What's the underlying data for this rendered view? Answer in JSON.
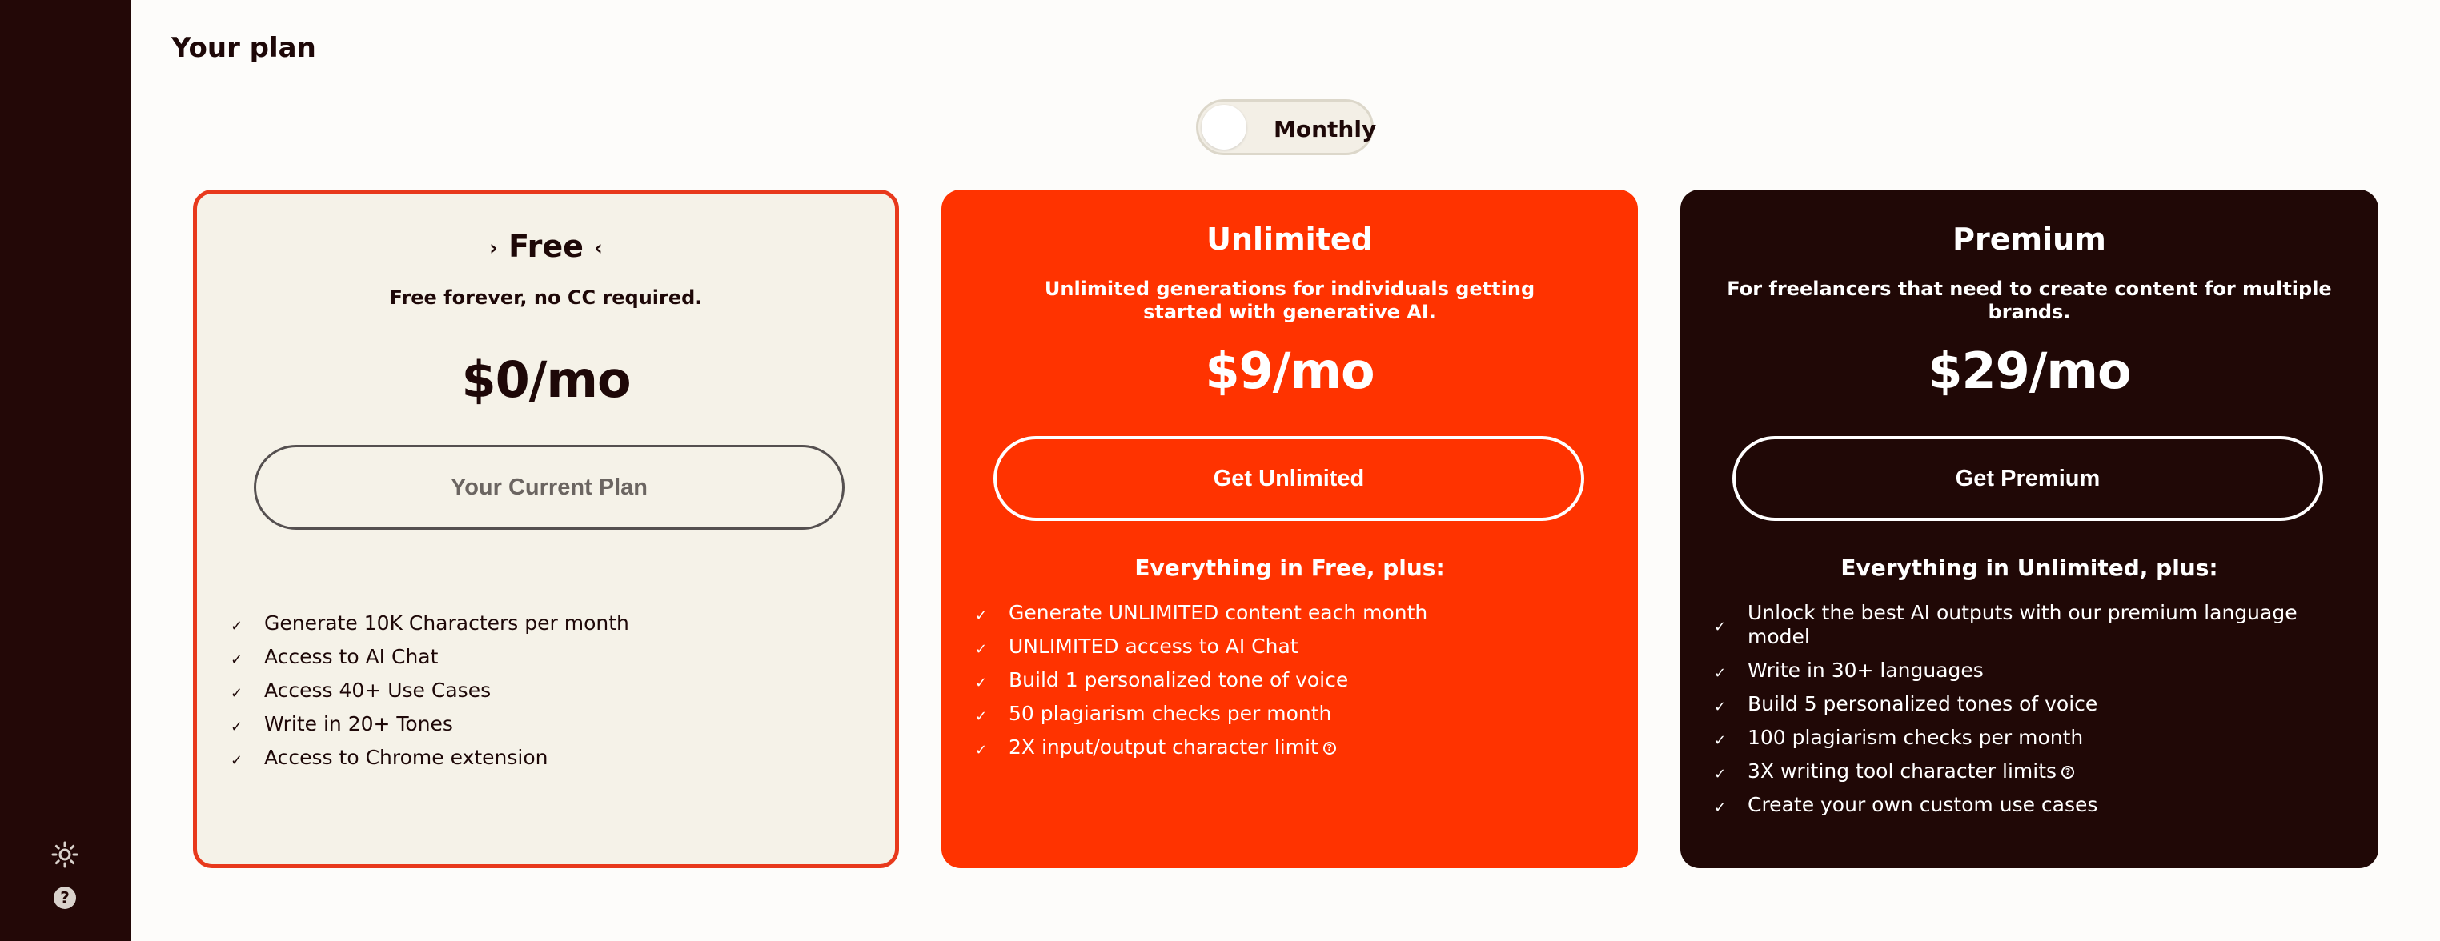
{
  "page": {
    "title": "Your plan"
  },
  "billing_toggle": {
    "label": "Monthly"
  },
  "sidebar": {
    "icons": [
      {
        "name": "theme-sun-icon"
      },
      {
        "name": "help-icon"
      }
    ]
  },
  "plans": {
    "free": {
      "title": "Free",
      "subtitle": "Free forever, no CC required.",
      "price": "$0/mo",
      "button": "Your Current Plan",
      "features": [
        "Generate 10K Characters per month",
        "Access to AI Chat",
        "Access 40+ Use Cases",
        "Write in 20+ Tones",
        "Access to Chrome extension"
      ]
    },
    "unlimited": {
      "title": "Unlimited",
      "subtitle": "Unlimited generations for individuals getting started with generative AI.",
      "price": "$9/mo",
      "button": "Get Unlimited",
      "features_heading": "Everything in Free, plus:",
      "features": [
        "Generate UNLIMITED content each month",
        "UNLIMITED access to AI Chat",
        "Build 1 personalized tone of voice",
        "50 plagiarism checks per month",
        "2X input/output character limit"
      ]
    },
    "premium": {
      "title": "Premium",
      "subtitle": "For freelancers that need to create content for multiple brands.",
      "price": "$29/mo",
      "button": "Get Premium",
      "features_heading": "Everything in Unlimited, plus:",
      "features": [
        "Unlock the best AI outputs with our premium language model",
        "Write in 30+ languages",
        "Build 5 personalized tones of voice",
        "100 plagiarism checks per month",
        "3X writing tool character limits",
        "Create your own custom use cases"
      ]
    }
  },
  "colors": {
    "sidebar": "#230807",
    "accent": "#ff3300",
    "premium_bg": "#200806",
    "free_bg": "#f5f2e8"
  }
}
